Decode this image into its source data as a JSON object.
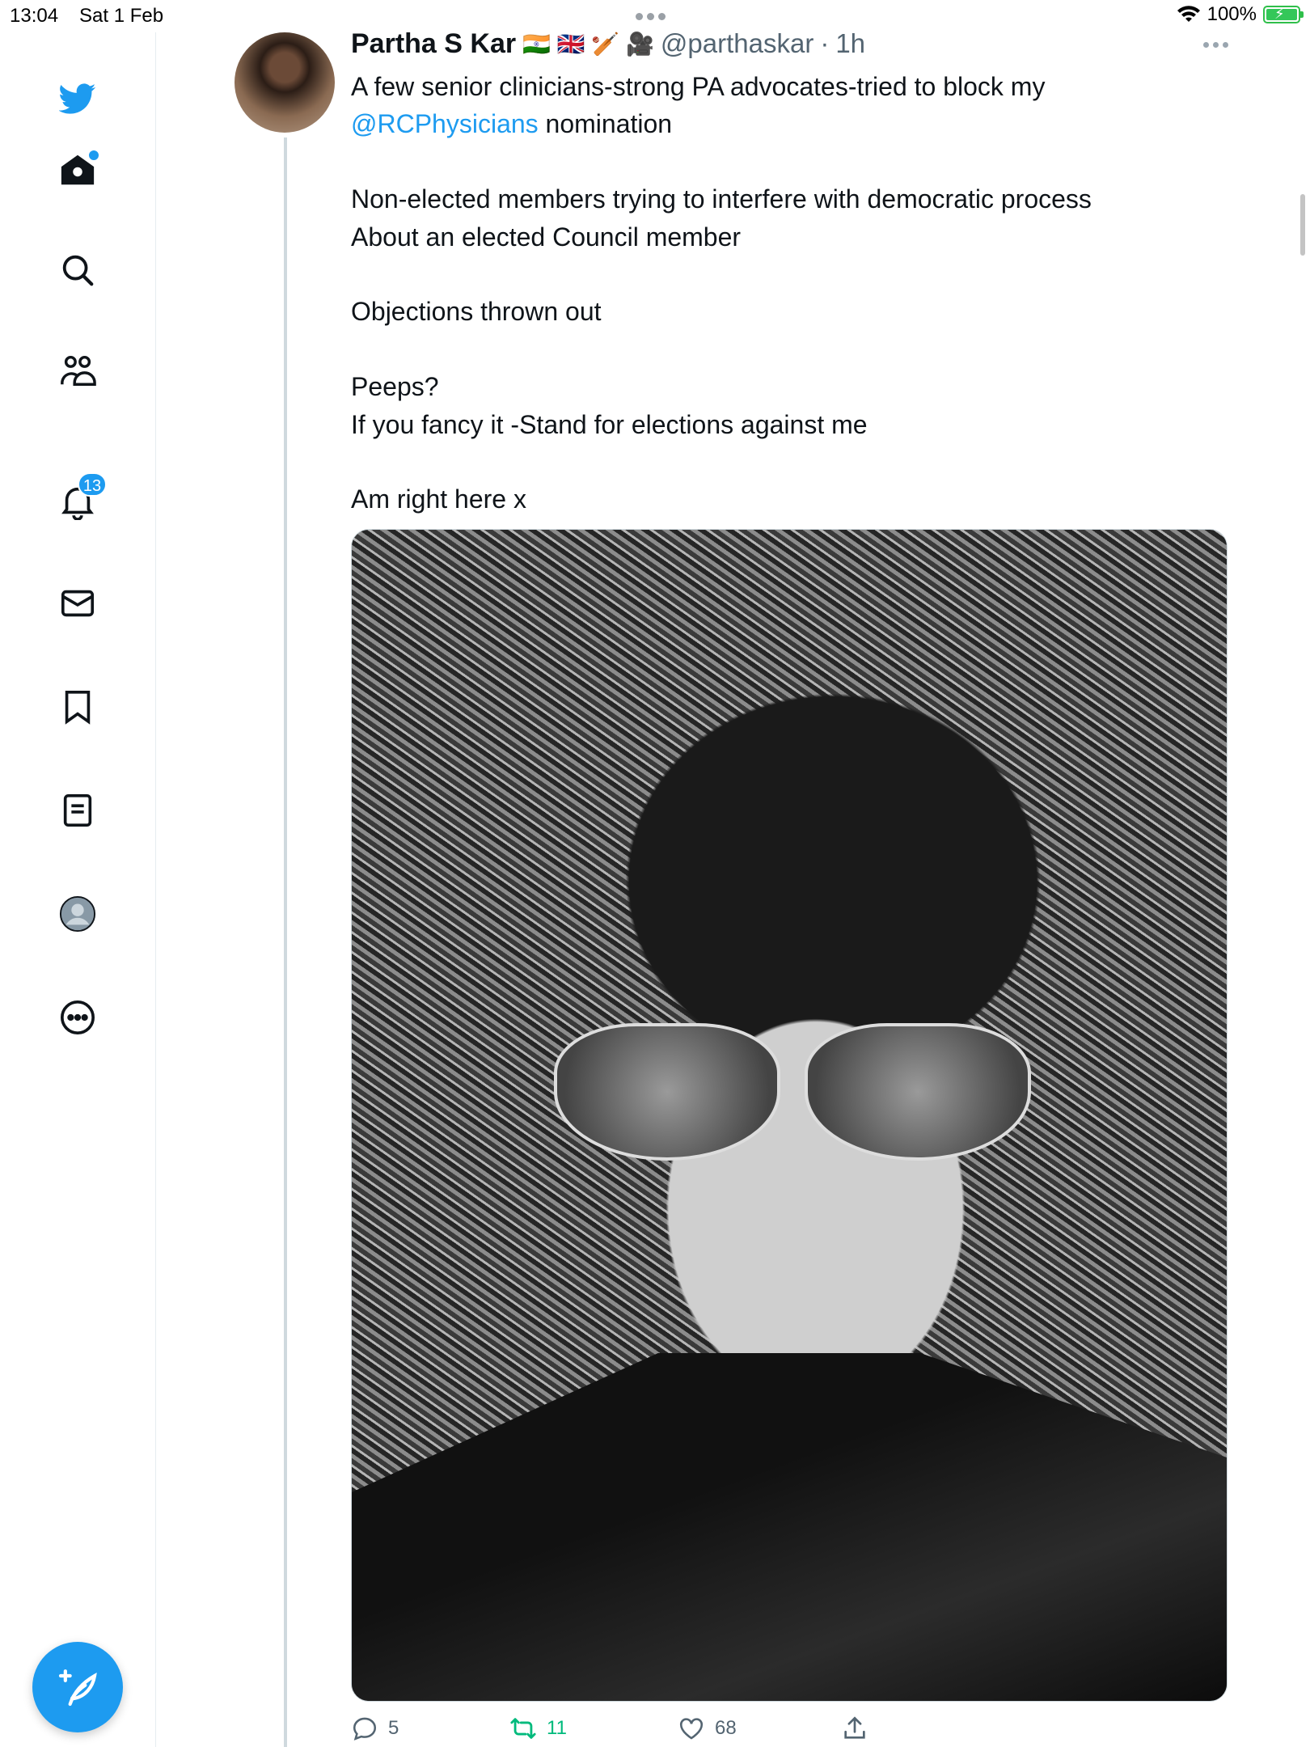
{
  "status_bar": {
    "time": "13:04",
    "date": "Sat 1 Feb",
    "battery": "100%",
    "battery_level": 1.0,
    "wifi_icon": "wifi-icon"
  },
  "sidebar": {
    "items": [
      {
        "name": "twitter-logo",
        "icon": "bird-icon"
      },
      {
        "name": "home",
        "icon": "home-icon",
        "has_dot": true
      },
      {
        "name": "explore",
        "icon": "search-icon"
      },
      {
        "name": "communities",
        "icon": "people-icon"
      },
      {
        "name": "notifications",
        "icon": "bell-icon",
        "badge": "13"
      },
      {
        "name": "messages",
        "icon": "envelope-icon"
      },
      {
        "name": "bookmarks",
        "icon": "bookmark-icon"
      },
      {
        "name": "lists",
        "icon": "list-icon"
      },
      {
        "name": "profile",
        "icon": "avatar-icon"
      },
      {
        "name": "more",
        "icon": "more-circle-icon"
      }
    ],
    "compose_icon": "feather-plus-icon"
  },
  "tweet": {
    "author_name": "Partha S Kar",
    "author_emojis": "🇮🇳 🇬🇧 🏏 🎥",
    "handle": "@parthaskar",
    "separator": "·",
    "time_ago": "1h",
    "text_line1_before": "A few senior clinicians-strong PA advocates-tried to block my",
    "mention": "@RCPhysicians",
    "text_line2_after": " nomination",
    "text_line3": "Non-elected members trying to interfere with  democratic process",
    "text_line4": "About an elected Council member",
    "text_line5": "Objections thrown out",
    "text_line6": "Peeps?",
    "text_line7": "If you fancy it -Stand for elections against me",
    "text_line8": "Am right here x",
    "media": "black-and-white selfie photo"
  },
  "actions": {
    "replies": "5",
    "retweets": "11",
    "likes": "68"
  },
  "colors": {
    "accent": "#1d9bf0",
    "retweet": "#00ba7c",
    "secondary_text": "#536471",
    "text": "#0f1419"
  }
}
